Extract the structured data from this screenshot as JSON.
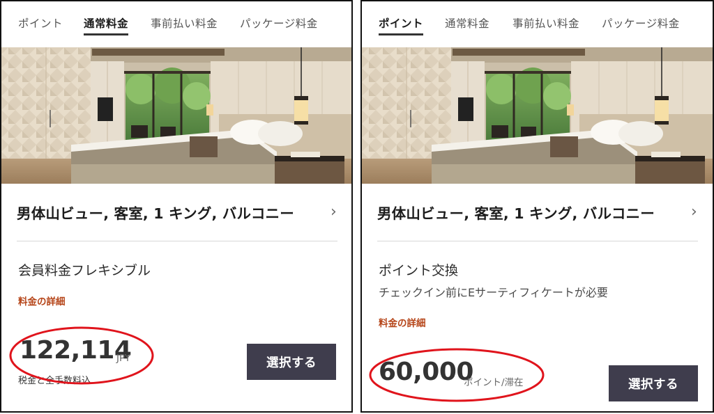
{
  "colors": {
    "accent_link": "#b6461a",
    "button_bg": "#3f3d4d",
    "annotation_ring": "#e0141c"
  },
  "left": {
    "tabs": [
      {
        "label": "ポイント",
        "active": false
      },
      {
        "label": "通常料金",
        "active": true
      },
      {
        "label": "事前払い料金",
        "active": false
      },
      {
        "label": "パッケージ料金",
        "active": false
      }
    ],
    "room_title": "男体山ビュー, 客室, 1 キング, バルコニー",
    "rate_name": "会員料金フレキシブル",
    "rate_details_link": "料金の詳細",
    "price": "122,114",
    "price_unit": "JPY",
    "price_note": "税金と全手数料込",
    "select_label": "選択する"
  },
  "right": {
    "tabs": [
      {
        "label": "ポイント",
        "active": true
      },
      {
        "label": "通常料金",
        "active": false
      },
      {
        "label": "事前払い料金",
        "active": false
      },
      {
        "label": "パッケージ料金",
        "active": false
      }
    ],
    "room_title": "男体山ビュー, 客室, 1 キング, バルコニー",
    "rate_name": "ポイント交換",
    "rate_note": "チェックイン前にEサーティフィケートが必要",
    "rate_details_link": "料金の詳細",
    "price": "60,000",
    "price_unit": "ポイント/滞在",
    "select_label": "選択する"
  }
}
